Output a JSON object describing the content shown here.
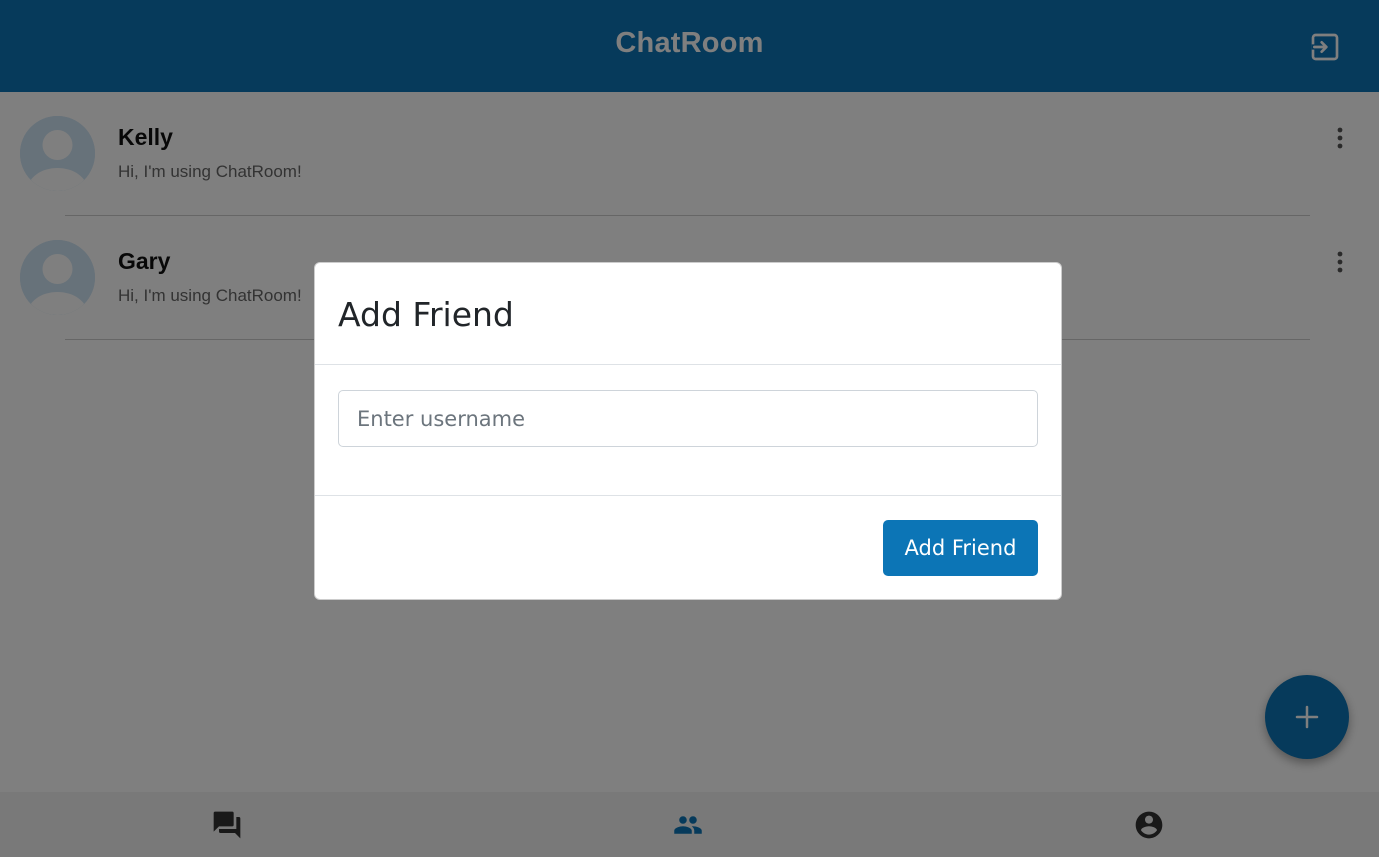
{
  "header": {
    "title": "ChatRoom",
    "logout_icon": "logout-icon"
  },
  "friends": [
    {
      "name": "Kelly",
      "status": "Hi, I'm using ChatRoom!"
    },
    {
      "name": "Gary",
      "status": "Hi, I'm using ChatRoom!"
    }
  ],
  "fab": {
    "icon": "plus-icon"
  },
  "bottom_nav": {
    "tabs": [
      {
        "icon": "chats-icon",
        "active": false
      },
      {
        "icon": "friends-icon",
        "active": true
      },
      {
        "icon": "profile-icon",
        "active": false
      }
    ]
  },
  "modal": {
    "title": "Add Friend",
    "input_placeholder": "Enter username",
    "input_value": "",
    "submit_label": "Add Friend"
  },
  "colors": {
    "primary": "#0c75b6",
    "nav_inactive": "#333333",
    "avatar_bg": "#cfe4f4",
    "avatar_fg": "#ffffff"
  }
}
